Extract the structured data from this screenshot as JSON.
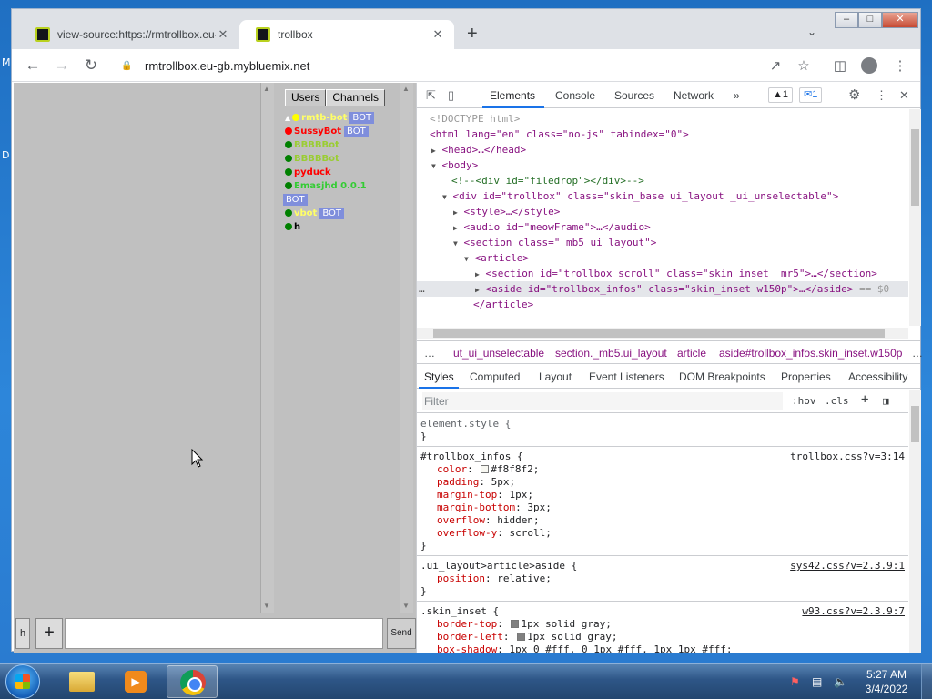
{
  "desktop": {
    "letter_m": "M",
    "letter_d": "D"
  },
  "browser": {
    "tabs": [
      {
        "title": "view-source:https://rmtrollbox.eu-",
        "close": "✕"
      },
      {
        "title": "trollbox",
        "close": "✕"
      }
    ],
    "new_tab": "+",
    "url": "rmtrollbox.eu-gb.mybluemix.net"
  },
  "trollbox": {
    "tabs": [
      "Users",
      "Channels"
    ],
    "users": [
      {
        "name": "rmtb-bot",
        "dot_color": "#ffff00",
        "name_color": "#ffff66",
        "bot": true,
        "prefix": "▲"
      },
      {
        "name": "SussyBot",
        "dot_color": "#ff0000",
        "name_color": "#ff0000",
        "bot": true
      },
      {
        "name": "BBBBBot",
        "dot_color": "#008000",
        "name_color": "#9acd32",
        "bot": false
      },
      {
        "name": "BBBBBot",
        "dot_color": "#008000",
        "name_color": "#9acd32",
        "bot": false
      },
      {
        "name": "pyduck",
        "dot_color": "#008000",
        "name_color": "#ff0000",
        "bot": false
      },
      {
        "name": "Emasjhd 0.0.1",
        "dot_color": "#008000",
        "name_color": "#33cc33",
        "bot": true
      },
      {
        "name": "vbot",
        "dot_color": "#008000",
        "name_color": "#ffff66",
        "bot": true
      },
      {
        "name": "h",
        "dot_color": "#008000",
        "name_color": "#000000",
        "bot": false
      }
    ],
    "bot_label": "BOT",
    "nick_button": "h",
    "add_button": "+",
    "send_button": "Send"
  },
  "devtools": {
    "tabs": [
      "Elements",
      "Console",
      "Sources",
      "Network"
    ],
    "more_tabs": "»",
    "warnings_count": "1",
    "messages_count": "1",
    "dom": {
      "doctype": "<!DOCTYPE html>",
      "html_open": "<html lang=\"en\" class=\"no-js\" tabindex=\"0\">",
      "head": "<head>…</head>",
      "body_open": "<body>",
      "filedrop_comment": "<!--<div id=\"filedrop\"></div>-->",
      "div_trollbox": "<div id=\"trollbox\" class=\"skin_base ui_layout _ui_unselectable\">",
      "style": "<style>…</style>",
      "audio": "<audio id=\"meowFrame\">…</audio>",
      "section": "<section class=\"_mb5 ui_layout\">",
      "article_open": "<article>",
      "section_scroll": "<section id=\"trollbox_scroll\" class=\"skin_inset _mr5\">…</section>",
      "aside": "<aside id=\"trollbox_infos\" class=\"skin_inset w150p\">…</aside>",
      "aside_eq": "== $0",
      "article_close": "</article>",
      "ellipsis": "…"
    },
    "breadcrumbs": [
      "…",
      "ut_ui_unselectable",
      "section._mb5.ui_layout",
      "article",
      "aside#trollbox_infos.skin_inset.w150p",
      "…"
    ],
    "styles_tabs": [
      "Styles",
      "Computed",
      "Layout",
      "Event Listeners",
      "DOM Breakpoints",
      "Properties",
      "Accessibility"
    ],
    "filter_placeholder": "Filter",
    "hov": ":hov",
    "cls": ".cls",
    "plus": "+",
    "rules": [
      {
        "selector": "element.style {",
        "source": "",
        "props": [],
        "close": "}"
      },
      {
        "selector": "#trollbox_infos {",
        "source": "trollbox.css?v=3:14",
        "props": [
          [
            "color",
            "#f8f8f2"
          ],
          [
            "padding",
            "5px"
          ],
          [
            "margin-top",
            "1px"
          ],
          [
            "margin-bottom",
            "3px"
          ],
          [
            "overflow",
            "hidden"
          ],
          [
            "overflow-y",
            "scroll"
          ]
        ],
        "close": "}"
      },
      {
        "selector": ".ui_layout>article>aside {",
        "source": "sys42.css?v=2.3.9:1",
        "props": [
          [
            "position",
            "relative"
          ]
        ],
        "close": "}"
      },
      {
        "selector": ".skin_inset {",
        "source": "w93.css?v=2.3.9:7",
        "props": [
          [
            "border-top",
            "1px solid gray"
          ],
          [
            "border-left",
            "1px solid gray"
          ],
          [
            "box-shadow",
            "1px 0 #fff, 0 1px #fff, 1px 1px #fff"
          ]
        ],
        "close": ""
      }
    ],
    "colors": {
      "swatch_f8": "#f8f8f2",
      "gray": "#808080"
    }
  },
  "taskbar": {
    "time": "5:27 AM",
    "date": "3/4/2022"
  }
}
